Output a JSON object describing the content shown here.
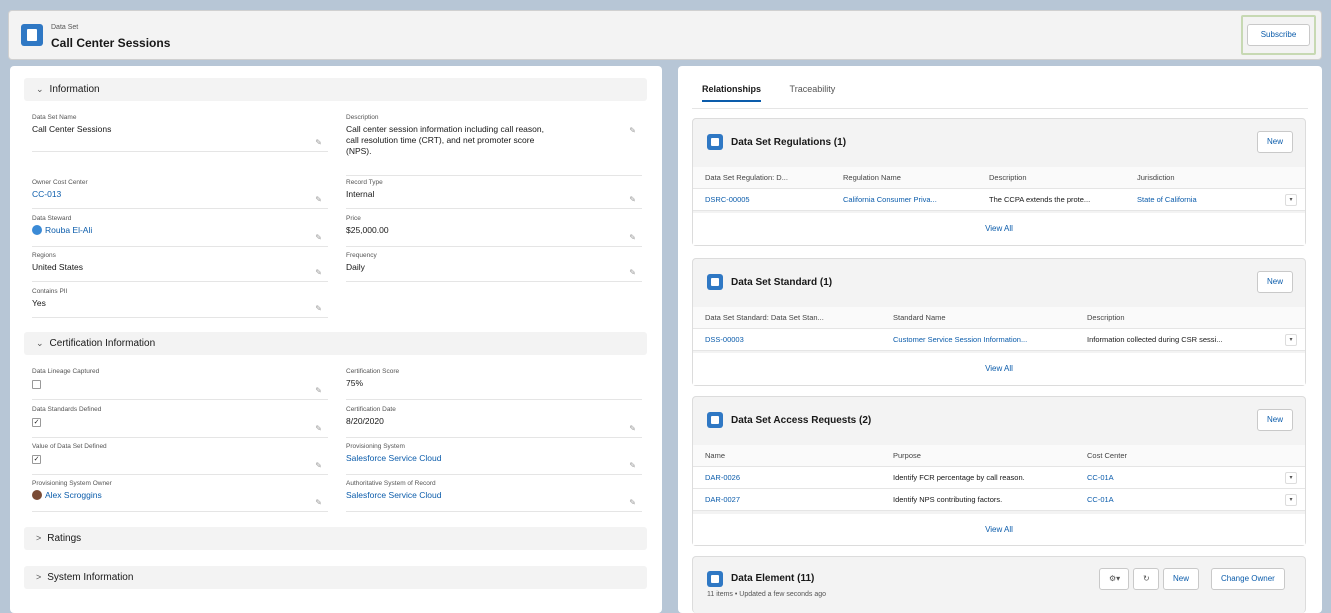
{
  "header": {
    "object_label": "Data Set",
    "title": "Call Center Sessions",
    "subscribe_label": "Subscribe"
  },
  "information": {
    "section_label": "Information",
    "fields": {
      "data_set_name": {
        "label": "Data Set Name",
        "value": "Call Center Sessions"
      },
      "description": {
        "label": "Description",
        "value_line1": "Call center session information including call reason,",
        "value_line2": "call resolution time (CRT), and net promoter score",
        "value_line3": "(NPS)."
      },
      "owner_cost_center": {
        "label": "Owner Cost Center",
        "value": "CC-013"
      },
      "record_type": {
        "label": "Record Type",
        "value": "Internal"
      },
      "data_steward": {
        "label": "Data Steward",
        "value": "Rouba El-Ali"
      },
      "price": {
        "label": "Price",
        "value": "$25,000.00"
      },
      "regions": {
        "label": "Regions",
        "value": "United States"
      },
      "frequency": {
        "label": "Frequency",
        "value": "Daily"
      },
      "contains_pii": {
        "label": "Contains PII",
        "value": "Yes"
      }
    }
  },
  "certification": {
    "section_label": "Certification Information",
    "fields": {
      "data_lineage_captured": {
        "label": "Data Lineage Captured"
      },
      "certification_score": {
        "label": "Certification Score",
        "value": "75%"
      },
      "data_standards_defined": {
        "label": "Data Standards Defined"
      },
      "certification_date": {
        "label": "Certification Date",
        "value": "8/20/2020"
      },
      "value_of_data_set_defined": {
        "label": "Value of Data Set Defined"
      },
      "provisioning_system": {
        "label": "Provisioning System",
        "value": "Salesforce Service Cloud"
      },
      "provisioning_system_owner": {
        "label": "Provisioning System Owner",
        "value": "Alex Scroggins"
      },
      "authoritative_system": {
        "label": "Authoritative System of Record",
        "value": "Salesforce Service Cloud"
      }
    }
  },
  "collapsed_sections": {
    "ratings": "Ratings",
    "system_information": "System Information"
  },
  "tabs": {
    "relationships": "Relationships",
    "traceability": "Traceability"
  },
  "regulations_card": {
    "title": "Data Set Regulations (1)",
    "new_label": "New",
    "columns": [
      "Data Set Regulation: D...",
      "Regulation Name",
      "Description",
      "Jurisdiction"
    ],
    "rows": [
      [
        "DSRC-00005",
        "California Consumer Priva...",
        "The CCPA extends the prote...",
        "State of California"
      ]
    ],
    "view_all": "View All"
  },
  "standard_card": {
    "title": "Data Set Standard (1)",
    "new_label": "New",
    "columns": [
      "Data Set Standard: Data Set Stan...",
      "Standard Name",
      "Description"
    ],
    "rows": [
      [
        "DSS-00003",
        "Customer Service Session Information...",
        "Information collected during CSR sessi..."
      ]
    ],
    "view_all": "View All"
  },
  "access_card": {
    "title": "Data Set Access Requests (2)",
    "new_label": "New",
    "columns": [
      "Name",
      "Purpose",
      "Cost Center"
    ],
    "rows": [
      [
        "DAR-0026",
        "Identify FCR percentage by call reason.",
        "CC-01A"
      ],
      [
        "DAR-0027",
        "Identify NPS contributing factors.",
        "CC-01A"
      ]
    ],
    "view_all": "View All"
  },
  "element_card": {
    "title": "Data Element (11)",
    "subtitle": "11 items • Updated a few seconds ago",
    "new_label": "New",
    "change_owner_label": "Change Owner"
  },
  "colors": {
    "brand": "#2f78c4",
    "link": "#0b5cab",
    "page_bg": "#b7c6d6"
  },
  "icons": [
    "data-set-icon",
    "chevron-down-icon",
    "chevron-right-icon",
    "pencil-icon",
    "settings-icon",
    "refresh-icon",
    "row-menu-icon"
  ]
}
